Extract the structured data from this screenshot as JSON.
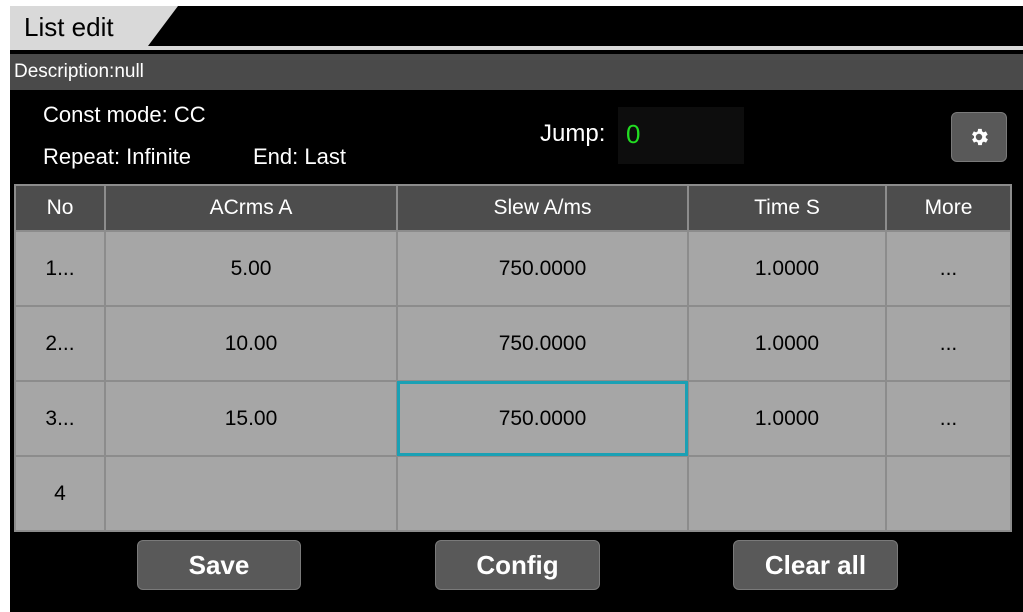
{
  "tab": {
    "title": "List edit"
  },
  "description": {
    "label": "Description:null"
  },
  "info": {
    "const_mode": "Const mode: CC",
    "repeat": "Repeat: Infinite",
    "end": "End: Last",
    "jump_label": "Jump:",
    "jump_value": "0"
  },
  "settings_icon": "gear-icon",
  "table": {
    "headers": [
      "No",
      "ACrms A",
      "Slew A/ms",
      "Time S",
      "More"
    ],
    "rows": [
      [
        "1...",
        "5.00",
        "750.0000",
        "1.0000",
        "..."
      ],
      [
        "2...",
        "10.00",
        "750.0000",
        "1.0000",
        "..."
      ],
      [
        "3...",
        "15.00",
        "750.0000",
        "1.0000",
        "..."
      ],
      [
        "4",
        "",
        "",
        "",
        ""
      ]
    ]
  },
  "buttons": {
    "save": "Save",
    "config": "Config",
    "clear_all": "Clear all"
  },
  "colors": {
    "jump_value": "#22dd22",
    "selected_cell_border": "#1aa0b4",
    "cell_bg": "#a6a6a6",
    "header_bg": "#4d4d4d"
  }
}
